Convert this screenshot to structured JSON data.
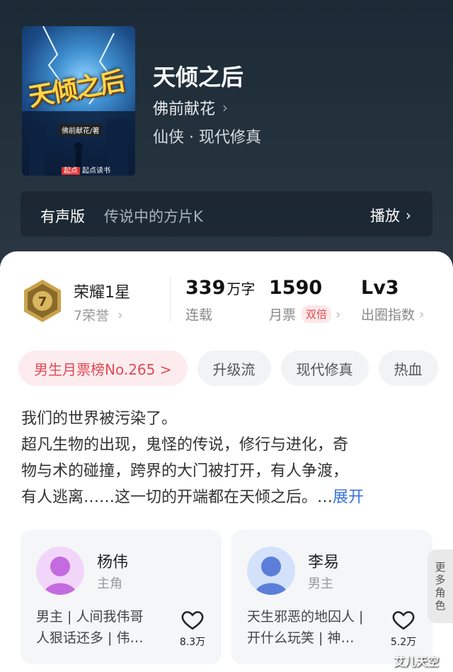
{
  "book": {
    "title": "天倾之后",
    "author": "佛前献花",
    "genre": "仙侠 · 现代修真",
    "cover": {
      "title_text": "天倾之后",
      "author_text": "佛前献花/著",
      "publisher_mark": "起点",
      "publisher_text": "起点读书"
    }
  },
  "audio": {
    "label": "有声版",
    "title": "传说中的方片K",
    "play_label": "播放"
  },
  "stats": {
    "honor_title": "荣耀1星",
    "honor_sub": "7荣誉",
    "medal_number": "7",
    "words_num": "339",
    "words_unit": "万字",
    "words_label": "连载",
    "tickets_num": "1590",
    "tickets_label": "月票",
    "tickets_badge": "双倍",
    "level_num": "Lv3",
    "level_label": "出圈指数"
  },
  "tags": [
    "男生月票榜No.265 >",
    "升级流",
    "现代修真",
    "热血"
  ],
  "description": {
    "lines": [
      "我们的世界被污染了。",
      "超凡生物的出现，鬼怪的传说，修行与进化，奇",
      "物与术的碰撞，跨界的大门被打开，有人争渡，",
      "有人逃离……这一切的开端都在天倾之后。…"
    ],
    "expand_label": "展开"
  },
  "characters": [
    {
      "name": "杨伟",
      "role": "主角",
      "desc_line1": "男主 | 人间我伟哥",
      "desc_line2": "人狠话还多 | 伟…",
      "likes": "8.3万",
      "avatar_color": "#c46be0"
    },
    {
      "name": "李易",
      "role": "男主",
      "desc_line1": "天生邪恶的地囚人 |",
      "desc_line2": "开什么玩笑 | 神…",
      "likes": "5.2万",
      "avatar_color": "#5b7fd8"
    }
  ],
  "more_roles": [
    "更",
    "多",
    "角",
    "色"
  ],
  "watermark": "艾儿天空",
  "colors": {
    "accent_red": "#e14a55",
    "link_blue": "#3b72d6",
    "hero_bg": "#22303b"
  },
  "icons": {
    "chevron": "›",
    "heart": "heart-icon",
    "medal": "medal-icon"
  }
}
